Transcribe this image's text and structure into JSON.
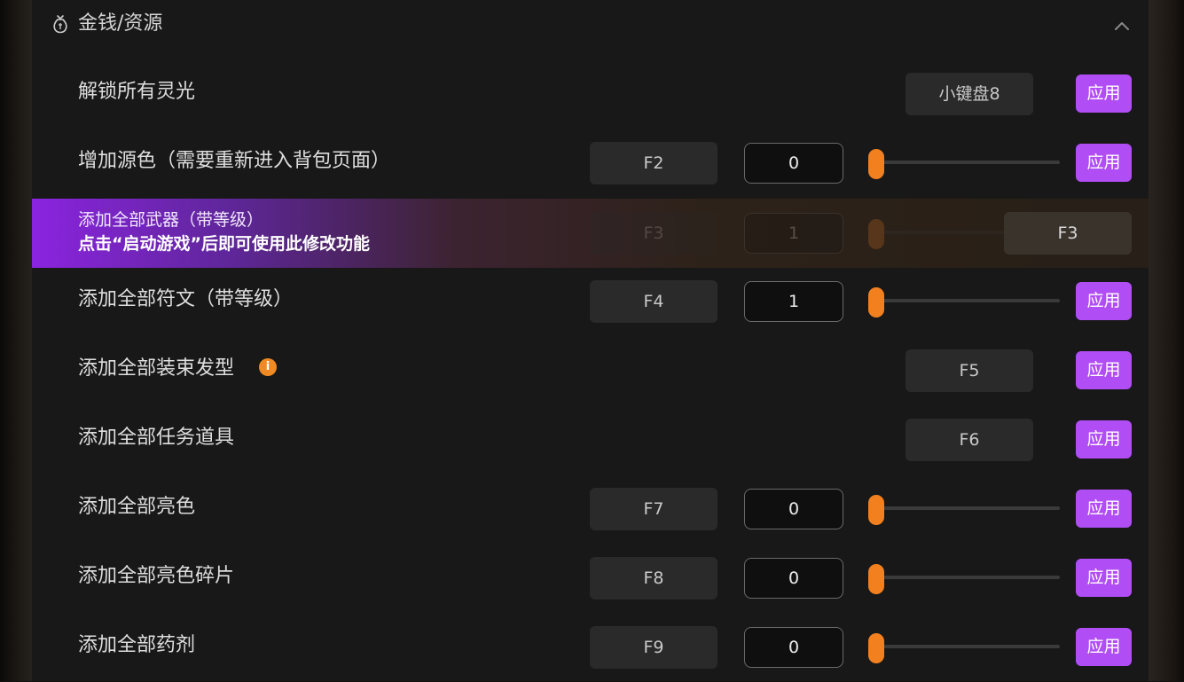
{
  "section": {
    "title": "金钱/资源",
    "icon": "money-bag-icon",
    "collapse_icon": "chevron-up-icon"
  },
  "colors": {
    "accent_purple": "#b14df5",
    "slider_orange": "#f3801f",
    "info_orange": "#f08a24"
  },
  "rows": [
    {
      "label": "解锁所有灵光",
      "hotkey": "小键盘8",
      "apply": "应用"
    },
    {
      "label": "增加源色（需要重新进入背包页面）",
      "hotkey": "F2",
      "value": "0",
      "slider": 0,
      "apply": "应用"
    },
    {
      "label": "添加全部武器（带等级）",
      "hotkey": "F3",
      "value": "1",
      "slider": 0,
      "hint": "点击“启动游戏”后即可使用此修改功能",
      "hotkey_alt": "F3"
    },
    {
      "label": "添加全部符文（带等级）",
      "hotkey": "F4",
      "value": "1",
      "slider": 0,
      "apply": "应用"
    },
    {
      "label": "添加全部装束发型",
      "info": "i",
      "hotkey": "F5",
      "apply": "应用"
    },
    {
      "label": "添加全部任务道具",
      "hotkey": "F6",
      "apply": "应用"
    },
    {
      "label": "添加全部亮色",
      "hotkey": "F7",
      "value": "0",
      "slider": 0,
      "apply": "应用"
    },
    {
      "label": "添加全部亮色碎片",
      "hotkey": "F8",
      "value": "0",
      "slider": 0,
      "apply": "应用"
    },
    {
      "label": "添加全部药剂",
      "hotkey": "F9",
      "value": "0",
      "slider": 0,
      "apply": "应用"
    }
  ]
}
